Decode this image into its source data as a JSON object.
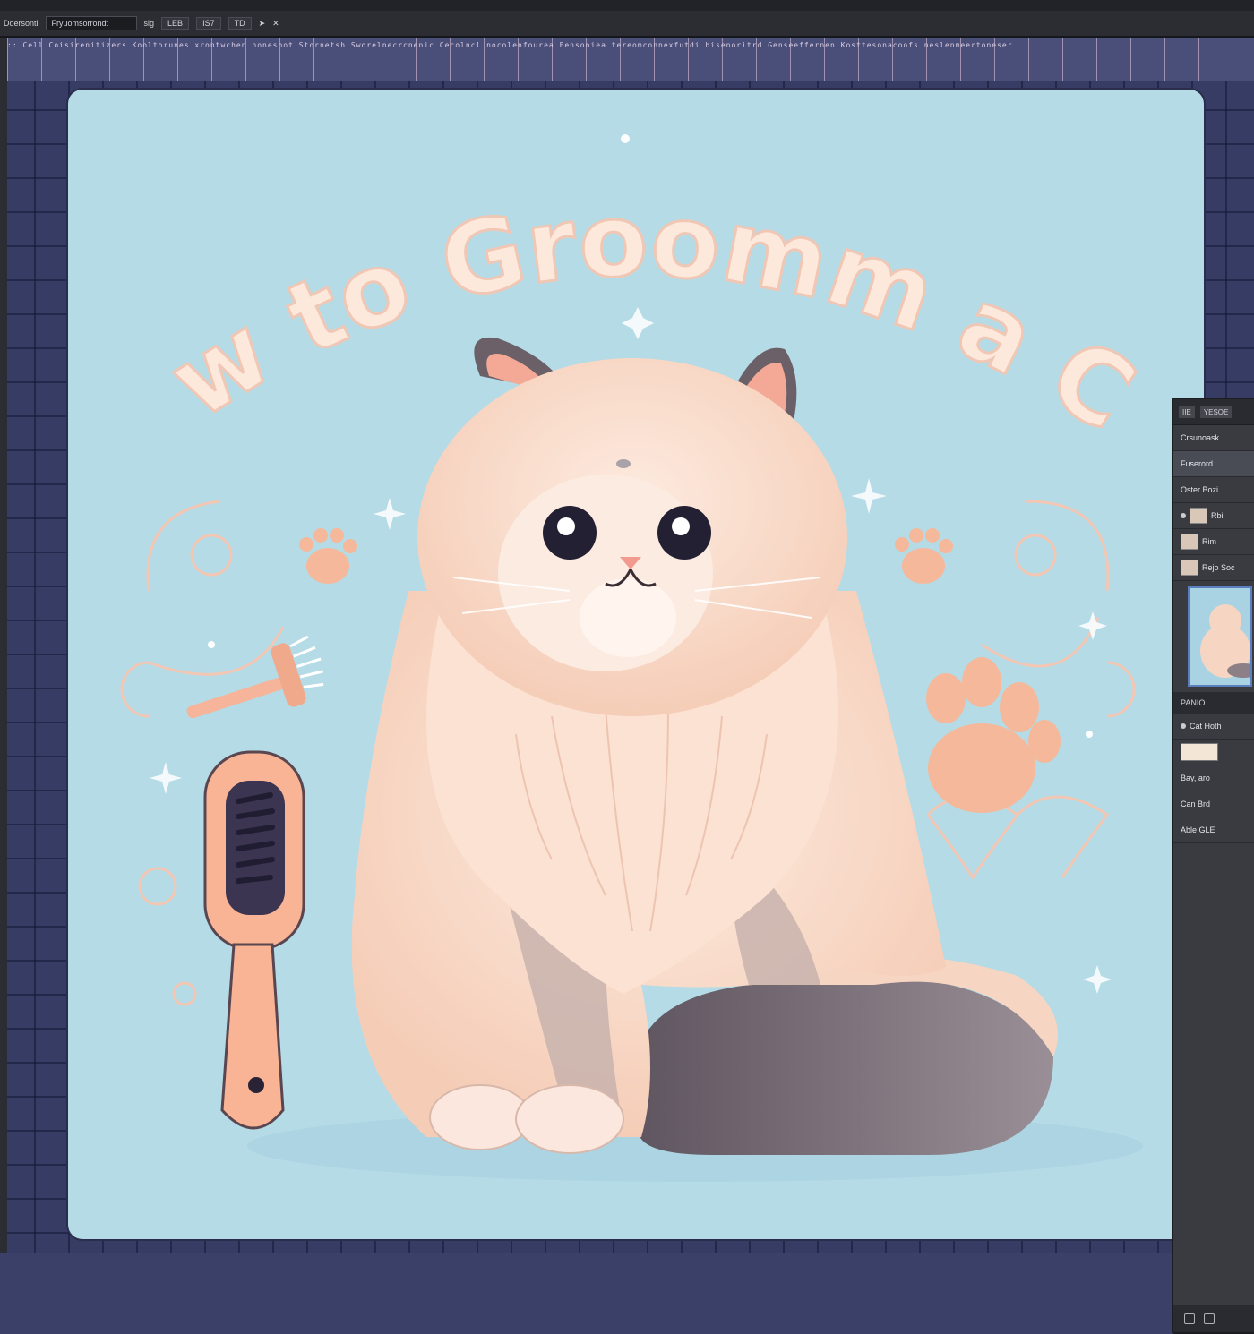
{
  "toolbar": {
    "tool_label": "Doersonti",
    "file_field": "Fryuomsorrondt",
    "extra_1": "sig",
    "extra_2": "LEB",
    "extra_3": "IS7"
  },
  "canvas": {
    "title": "How to Groomm a Cat",
    "background": "#b4dbe6",
    "cat_fur": "#f7dccc",
    "accent": "#f3b59a"
  },
  "layers_panel": {
    "tab_1": "IIE",
    "tab_2": "YESOE",
    "header_label": "Crsunoask",
    "group_label": "Fuserord",
    "layers": [
      {
        "label": "Oster Bozi"
      },
      {
        "label": "Rbi"
      },
      {
        "label": "Rim"
      },
      {
        "label": "Rejo Soc"
      }
    ],
    "section_label": "PANIO",
    "properties": [
      {
        "label": "Cat Hoth"
      },
      {
        "label": "Bay, aro"
      },
      {
        "label": "Can Brd"
      },
      {
        "label": "Able GLE"
      }
    ]
  }
}
